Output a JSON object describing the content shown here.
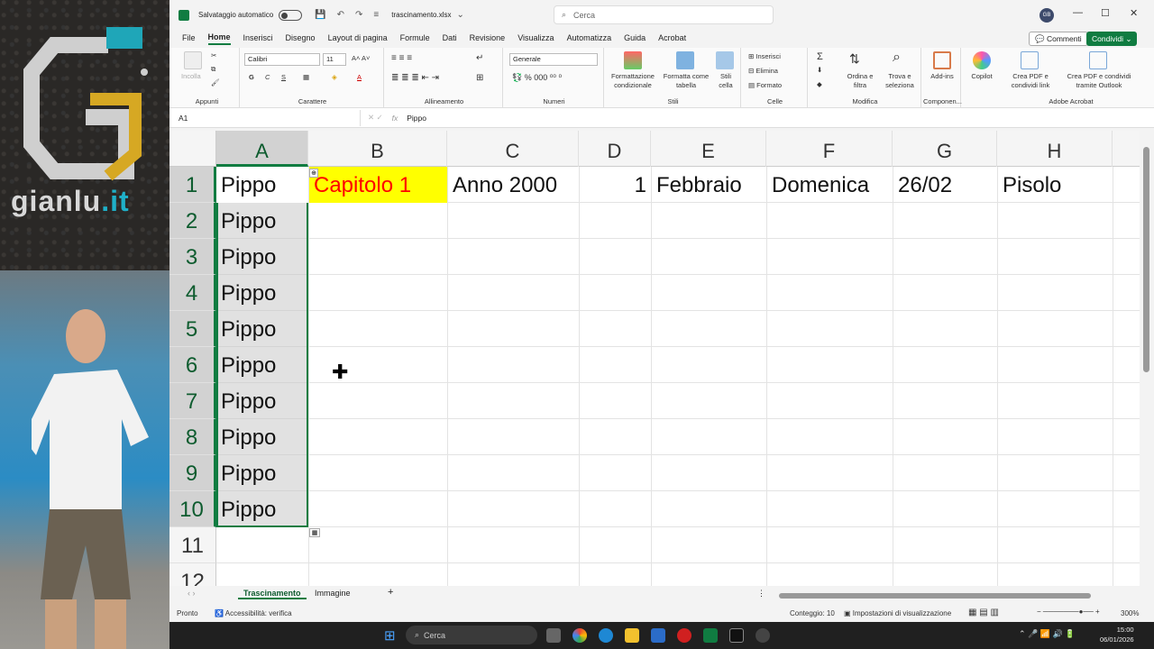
{
  "brand": {
    "prefix": "gianlu",
    "suffix": ".it"
  },
  "titlebar": {
    "autosave_label": "Salvataggio automatico",
    "filename": "trascinamento.xlsx",
    "search_placeholder": "Cerca",
    "avatar_initials": "GB"
  },
  "menu": {
    "tabs": [
      "File",
      "Home",
      "Inserisci",
      "Disegno",
      "Layout di pagina",
      "Formule",
      "Dati",
      "Revisione",
      "Visualizza",
      "Automatizza",
      "Guida",
      "Acrobat"
    ],
    "active_tab": "Home",
    "comments_label": "Commenti",
    "share_label": "Condividi"
  },
  "ribbon": {
    "groups": [
      "Appunti",
      "Carattere",
      "Allineamento",
      "Numeri",
      "Stili",
      "Celle",
      "Modifica",
      "Componen...",
      "Adobe Acrobat"
    ],
    "paste_label": "Incolla",
    "font_name": "Calibri",
    "font_size": "11",
    "number_format": "Generale",
    "cond_format": "Formattazione condizionale",
    "format_table": "Formatta come tabella",
    "cell_styles": "Stili cella",
    "insert": "Inserisci",
    "delete": "Elimina",
    "format": "Formato",
    "sort_filter": "Ordina e filtra",
    "find_select": "Trova e seleziona",
    "addins": "Add-ins",
    "copilot": "Copilot",
    "pdf_link": "Crea PDF e condividi link",
    "pdf_outlook": "Crea PDF e condividi tramite Outlook"
  },
  "formula_bar": {
    "name_box": "A1",
    "fx": "fx",
    "content": "Pippo"
  },
  "grid": {
    "columns": [
      "A",
      "B",
      "C",
      "D",
      "E",
      "F",
      "G",
      "H"
    ],
    "selected_column": "A",
    "rows": [
      "1",
      "2",
      "3",
      "4",
      "5",
      "6",
      "7",
      "8",
      "9",
      "10",
      "11",
      "12"
    ],
    "row1": {
      "A": "Pippo",
      "B": "Capitolo 1",
      "C": "Anno 2000",
      "D": "1",
      "E": "Febbraio",
      "F": "Domenica",
      "G": "26/02",
      "H": "Pisolo"
    },
    "colA_values": [
      "Pippo",
      "Pippo",
      "Pippo",
      "Pippo",
      "Pippo",
      "Pippo",
      "Pippo",
      "Pippo",
      "Pippo"
    ],
    "highlight_fill": "#ffff00",
    "highlight_text": "#ff0000"
  },
  "sheets": {
    "tabs": [
      "Trascinamento",
      "Immagine"
    ],
    "active": "Trascinamento",
    "add": "+"
  },
  "status": {
    "ready": "Pronto",
    "accessibility": "Accessibilità: verifica",
    "count": "Conteggio: 10",
    "view_settings": "Impostazioni di visualizzazione",
    "zoom": "300%"
  },
  "taskbar": {
    "search": "Cerca",
    "time": "15:00",
    "date": "06/01/2026"
  },
  "colors": {
    "excel_green": "#107c41",
    "selection_gray": "#d2d2d2"
  }
}
